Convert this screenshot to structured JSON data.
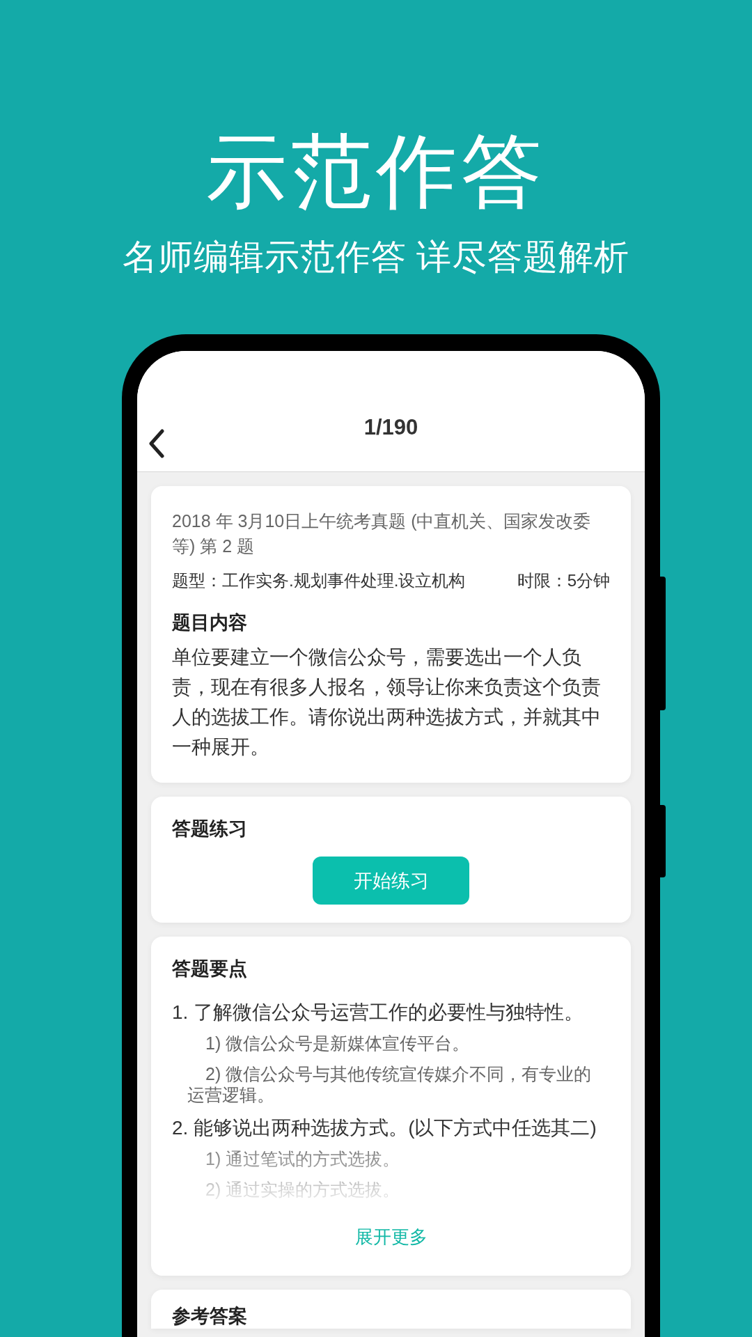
{
  "hero": {
    "title": "示范作答",
    "subtitle": "名师编辑示范作答 详尽答题解析"
  },
  "nav": {
    "title": "1/190"
  },
  "question_card": {
    "source": "2018 年 3月10日上午统考真题 (中直机关、国家发改委等) 第 2 题",
    "type": "题型：工作实务.规划事件处理.设立机构",
    "time_limit": "时限：5分钟",
    "heading": "题目内容",
    "content": "单位要建立一个微信公众号，需要选出一个人负责，现在有很多人报名，领导让你来负责这个负责人的选拔工作。请你说出两种选拔方式，并就其中一种展开。"
  },
  "practice_card": {
    "heading": "答题练习",
    "button": "开始练习"
  },
  "points_card": {
    "heading": "答题要点",
    "points": [
      {
        "text": "1. 了解微信公众号运营工作的必要性与独特性。",
        "children": [
          {
            "text": "1) 微信公众号是新媒体宣传平台。"
          },
          {
            "text": "2) 微信公众号与其他传统宣传媒介不同，有专业的运营逻辑。"
          }
        ]
      },
      {
        "text": "2. 能够说出两种选拔方式。(以下方式中任选其二)",
        "children": [
          {
            "text": "1) 通过笔试的方式选拔。"
          },
          {
            "text": "2) 通过实操的方式选拔。"
          }
        ]
      }
    ],
    "more_link": "展开更多"
  },
  "answer_card": {
    "heading": "参考答案"
  }
}
